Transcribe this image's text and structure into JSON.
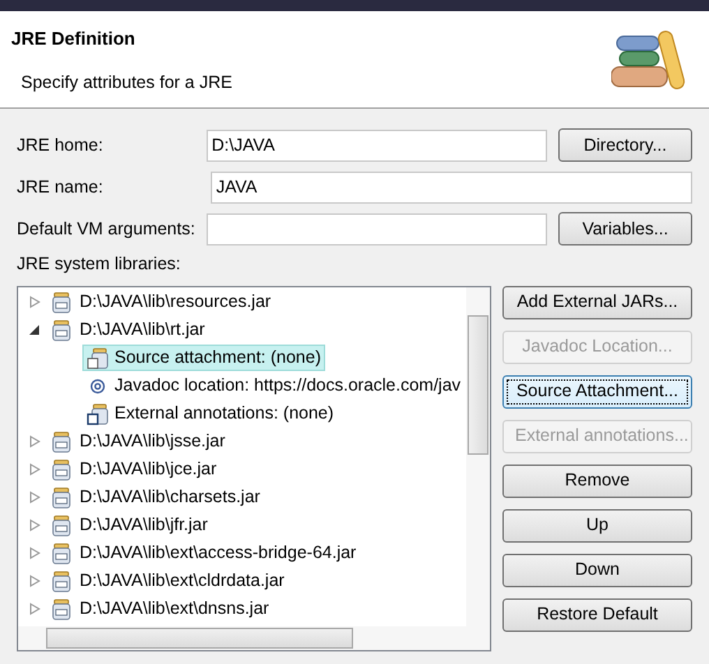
{
  "header": {
    "title": "JRE Definition",
    "subtitle": "Specify attributes for a JRE"
  },
  "fields": [
    {
      "label": "JRE home:",
      "value": "D:\\JAVA",
      "button": "Directory..."
    },
    {
      "label": "JRE name:",
      "value": "JAVA"
    },
    {
      "label": "Default VM arguments:",
      "button": "Variables..."
    }
  ],
  "libraries_label": "JRE system libraries:",
  "tree": [
    {
      "label": "D:\\JAVA\\lib\\resources.jar",
      "expanded": false
    },
    {
      "label": "D:\\JAVA\\lib\\rt.jar",
      "expanded": true,
      "children": [
        {
          "kind": "source",
          "label": "Source attachment: (none)",
          "selected": true
        },
        {
          "kind": "javadoc",
          "label": "Javadoc location: https://docs.oracle.com/jav",
          "selected": false
        },
        {
          "kind": "annotations",
          "label": "External annotations: (none)",
          "selected": false
        }
      ]
    },
    {
      "label": "D:\\JAVA\\lib\\jsse.jar",
      "expanded": false
    },
    {
      "label": "D:\\JAVA\\lib\\jce.jar",
      "expanded": false
    },
    {
      "label": "D:\\JAVA\\lib\\charsets.jar",
      "expanded": false
    },
    {
      "label": "D:\\JAVA\\lib\\jfr.jar",
      "expanded": false
    },
    {
      "label": "D:\\JAVA\\lib\\ext\\access-bridge-64.jar",
      "expanded": false
    },
    {
      "label": "D:\\JAVA\\lib\\ext\\cldrdata.jar",
      "expanded": false
    },
    {
      "label": "D:\\JAVA\\lib\\ext\\dnsns.jar",
      "expanded": false
    }
  ],
  "buttons": [
    {
      "label": "Add External JARs...",
      "disabled": false,
      "focused": false
    },
    {
      "label": "Javadoc Location...",
      "disabled": true,
      "focused": false
    },
    {
      "label": "Source Attachment...",
      "disabled": false,
      "focused": true
    },
    {
      "label": "External annotations...",
      "disabled": true,
      "focused": false
    },
    {
      "label": "Remove",
      "disabled": false,
      "focused": false
    },
    {
      "label": "Up",
      "disabled": false,
      "focused": false
    },
    {
      "label": "Down",
      "disabled": false,
      "focused": false
    },
    {
      "label": "Restore Default",
      "disabled": false,
      "focused": false
    }
  ]
}
